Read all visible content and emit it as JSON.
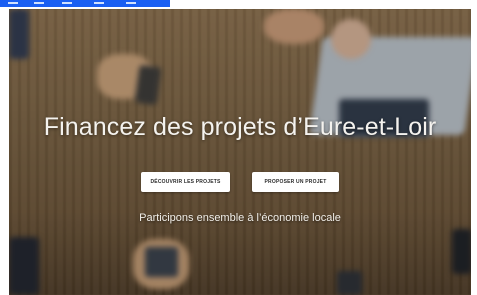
{
  "hero": {
    "title": "Financez des projets d’Eure-et-Loir",
    "primary_button": "DÉCOUVRIR LES PROJETS",
    "secondary_button": "PROPOSER UN PROJET",
    "tagline": "Participons ensemble à l’économie locale"
  },
  "colors": {
    "top_bar_accent": "#1a5ff2",
    "button_bg": "#ffffff",
    "title_text": "#f4f2ee"
  },
  "icons": {
    "background": "hero-background-image"
  }
}
